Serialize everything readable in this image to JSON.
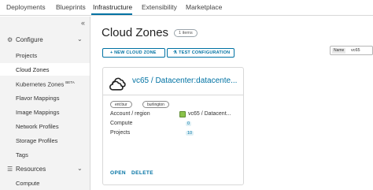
{
  "topnav": {
    "tabs": [
      {
        "label": "Deployments"
      },
      {
        "label": "Blueprints"
      },
      {
        "label": "Infrastructure"
      },
      {
        "label": "Extensibility"
      },
      {
        "label": "Marketplace"
      }
    ],
    "active": "Infrastructure"
  },
  "sidebar": {
    "collapse_glyph": "«",
    "sections": [
      {
        "label": "Configure",
        "icon": "gear-icon",
        "chevron": "⌄"
      },
      {
        "label": "Resources",
        "icon": "layers-icon",
        "chevron": "⌄"
      }
    ],
    "items": [
      {
        "label": "Projects"
      },
      {
        "label": "Cloud Zones"
      },
      {
        "label": "Kubernetes Zones",
        "badge": "BETA"
      },
      {
        "label": "Flavor Mappings"
      },
      {
        "label": "Image Mappings"
      },
      {
        "label": "Network Profiles"
      },
      {
        "label": "Storage Profiles"
      },
      {
        "label": "Tags"
      },
      {
        "label": "Compute"
      }
    ],
    "active_item": "Cloud Zones"
  },
  "main": {
    "title": "Cloud Zones",
    "count": "1 items",
    "buttons": {
      "new": "+ NEW CLOUD ZONE",
      "test": "TEST CONFIGURATION"
    },
    "filter": {
      "key": "Name",
      "value": "vc65"
    }
  },
  "card": {
    "name": "vc65 / Datacenter:datacente...",
    "tags": [
      "ent:bur",
      "burlington"
    ],
    "rows": {
      "account_label": "Account / region",
      "account_value": "vc65 / Datacent...",
      "compute_label": "Compute",
      "compute_value": "0",
      "projects_label": "Projects",
      "projects_value": "10"
    },
    "actions": {
      "open": "OPEN",
      "delete": "DELETE"
    }
  },
  "colors": {
    "accent": "#0072a3",
    "sidebar_bg": "#f3f3f3",
    "datacenter_icon": "#8bc34a"
  }
}
